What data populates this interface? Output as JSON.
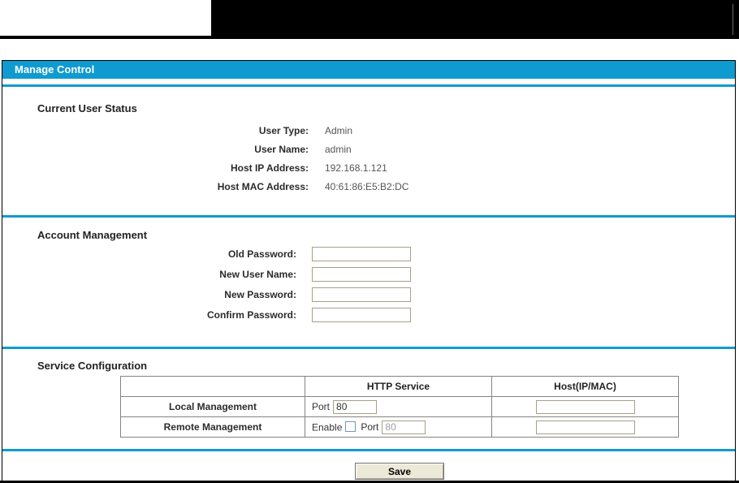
{
  "header": {
    "title": "Manage Control"
  },
  "status": {
    "heading": "Current User Status",
    "rows": [
      {
        "label": "User Type:",
        "value": "Admin"
      },
      {
        "label": "User Name:",
        "value": "admin"
      },
      {
        "label": "Host IP Address:",
        "value": "192.168.1.121"
      },
      {
        "label": "Host MAC Address:",
        "value": "40:61:86:E5:B2:DC"
      }
    ]
  },
  "account": {
    "heading": "Account Management",
    "fields": [
      {
        "label": "Old Password:",
        "value": ""
      },
      {
        "label": "New User Name:",
        "value": ""
      },
      {
        "label": "New Password:",
        "value": ""
      },
      {
        "label": "Confirm Password:",
        "value": ""
      }
    ]
  },
  "service": {
    "heading": "Service Configuration",
    "table": {
      "col_http": "HTTP Service",
      "col_host": "Host(IP/MAC)",
      "rows": [
        {
          "name": "Local Management",
          "port_label": "Port",
          "port_value": "80",
          "host_value": ""
        },
        {
          "name": "Remote Management",
          "enable_label": "Enable",
          "enable_checked": false,
          "port_label": "Port",
          "port_value": "80",
          "host_value": ""
        }
      ]
    }
  },
  "actions": {
    "save": "Save"
  },
  "colors": {
    "accent": "#0f9bd0"
  }
}
